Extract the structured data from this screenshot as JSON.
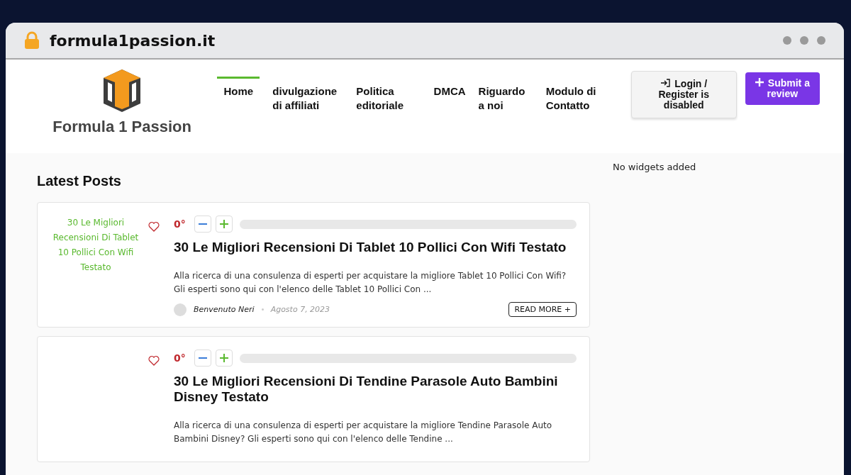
{
  "browser": {
    "url": "formula1passion.it"
  },
  "logo": {
    "text": "Formula 1 Passion"
  },
  "nav": [
    {
      "label": "Home",
      "selected": true
    },
    {
      "label": "divulgazione di affiliati",
      "selected": false
    },
    {
      "label": "Politica editoriale",
      "selected": false
    },
    {
      "label": "DMCA",
      "selected": false
    },
    {
      "label": "Riguardo a noi",
      "selected": false
    },
    {
      "label": "Modulo di Contatto",
      "selected": false
    }
  ],
  "login_button": "Login / Register is disabled",
  "submit_button": "Submit a review",
  "section_title": "Latest Posts",
  "sidebar": "No widgets added",
  "posts": [
    {
      "image_alt": "30 Le Migliori Recensioni Di Tablet 10 Pollici Con Wifi Testato",
      "score": "0°",
      "level": 0,
      "title": "30 Le Migliori Recensioni Di Tablet 10 Pollici Con Wifi Testato",
      "excerpt": "Alla ricerca di una consulenza di esperti per acquistare la migliore Tablet 10 Pollici Con Wifi? Gli esperti sono qui con l'elenco delle Tablet 10 Pollici Con ...",
      "author": "Benvenuto Neri",
      "date": "Agosto 7, 2023",
      "read_more": "READ MORE +"
    },
    {
      "score": "0°",
      "level": 0,
      "title": "30 Le Migliori Recensioni Di Tendine Parasole Auto Bambini Disney Testato",
      "excerpt": "Alla ricerca di una consulenza di esperti per acquistare la migliore Tendine Parasole Auto Bambini Disney? Gli esperti sono qui con l'elenco delle Tendine ..."
    }
  ]
}
